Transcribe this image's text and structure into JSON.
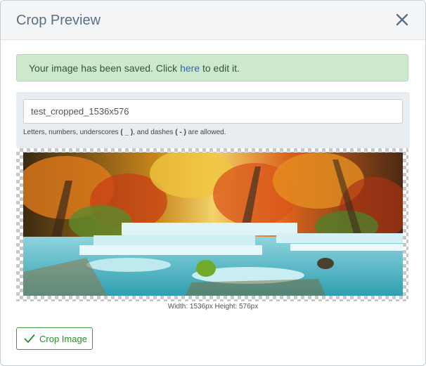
{
  "modal": {
    "title": "Crop Preview",
    "close_icon": "close-icon"
  },
  "alert": {
    "text_before": "Your image has been saved. Click ",
    "link": "here",
    "text_after": " to edit it."
  },
  "filename": {
    "value": "test_cropped_1536x576",
    "help_before": "Letters, numbers, underscores ",
    "help_underscore": "( _ )",
    "help_mid": ", and dashes ",
    "help_dash": "( - )",
    "help_after": " are allowed."
  },
  "preview": {
    "dimensions": "Width: 1536px Height: 576px"
  },
  "actions": {
    "crop_label": "Crop Image",
    "crop_icon": "checkmark-icon"
  },
  "colors": {
    "title": "#5a6f84",
    "alert_bg": "#cde9cd",
    "link": "#2a66b8",
    "button_green": "#2f8a2f"
  }
}
